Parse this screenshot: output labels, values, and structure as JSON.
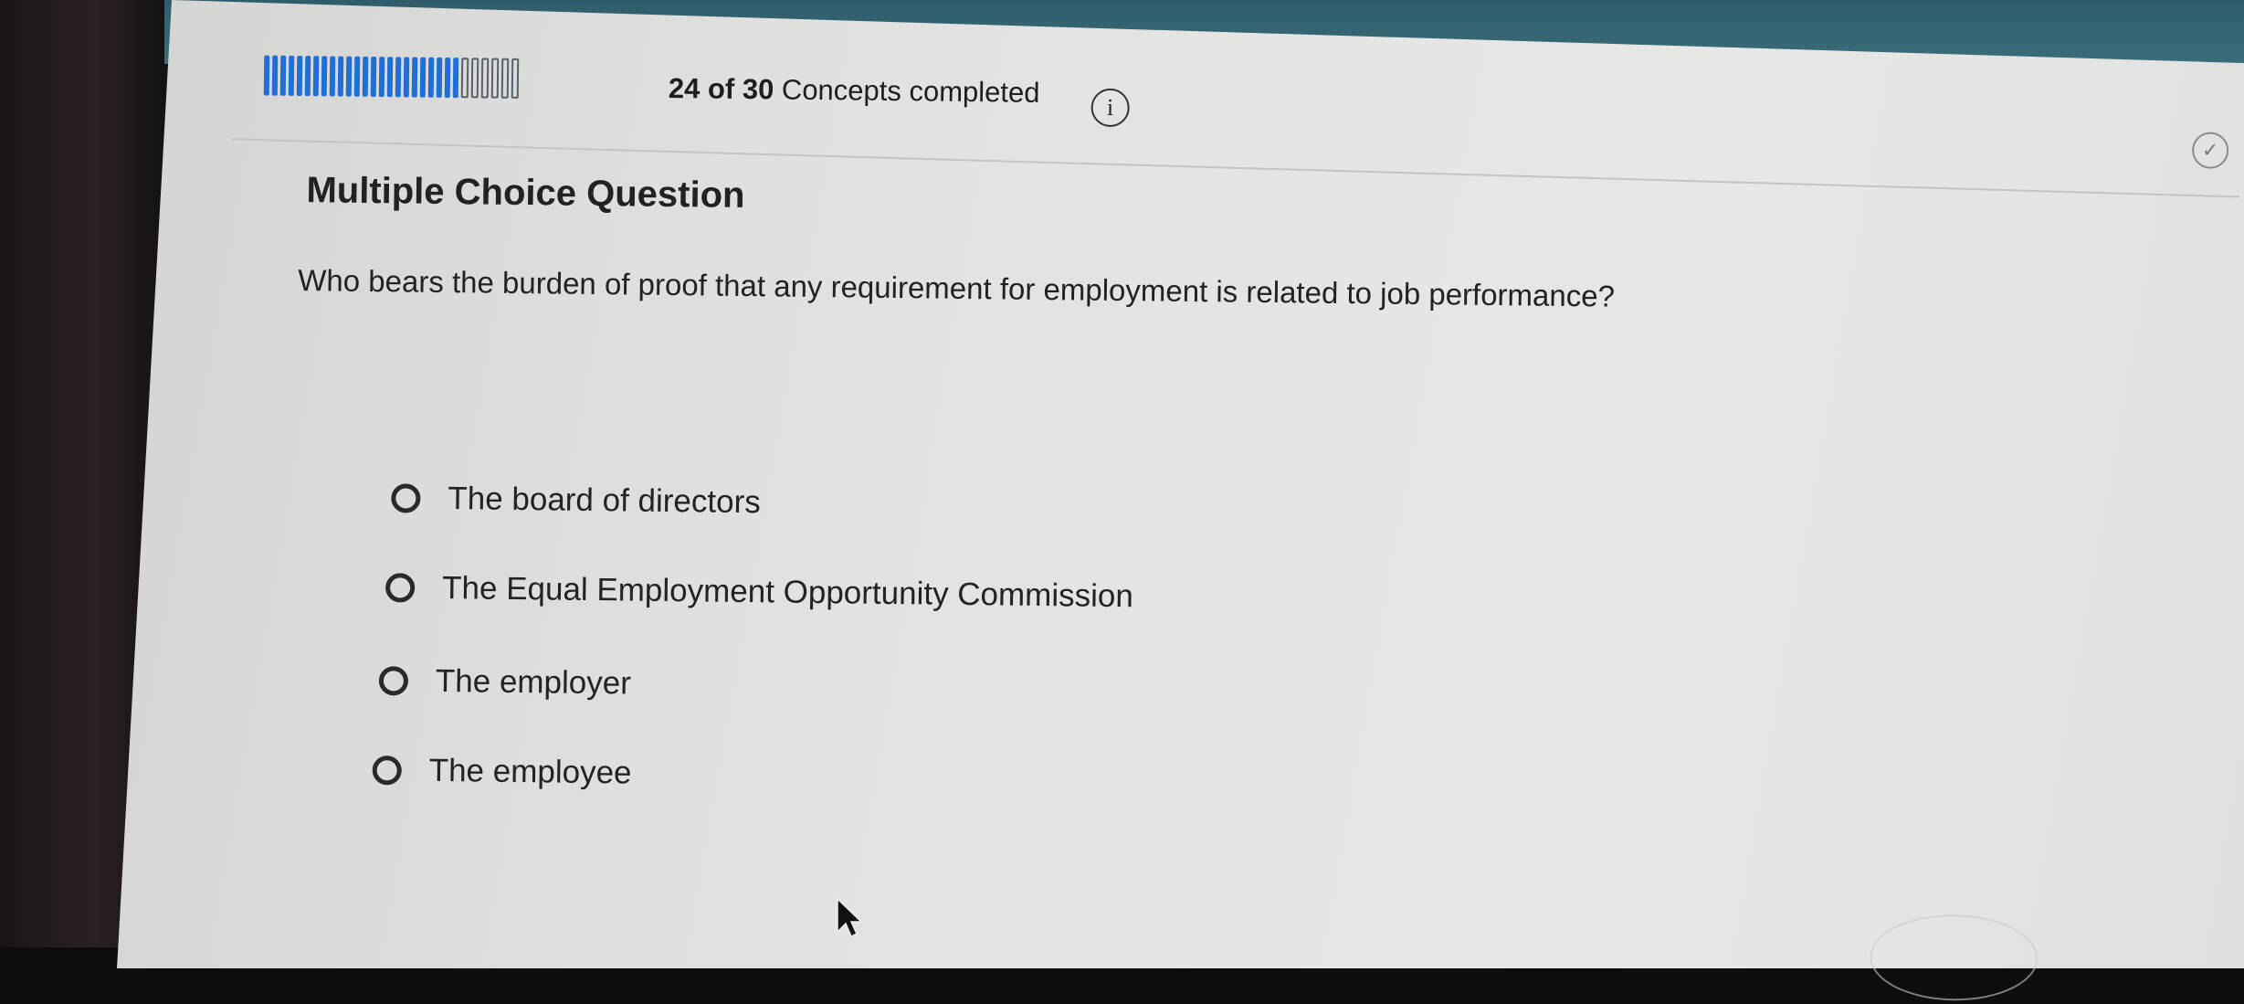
{
  "progress": {
    "completed": 24,
    "total": 30,
    "text_bold": "24 of 30",
    "text_rest": " Concepts completed",
    "info_icon": "i"
  },
  "question": {
    "type_label": "Multiple Choice Question",
    "prompt": "Who bears the burden of proof that any requirement for employment is related to job performance?",
    "options": [
      {
        "label": "The board of directors"
      },
      {
        "label": "The Equal Employment Opportunity Commission"
      },
      {
        "label": "The employer"
      },
      {
        "label": "The employee"
      }
    ]
  },
  "icons": {
    "info": "info-icon",
    "check": "check-circle-icon",
    "cursor": "mouse-cursor-icon"
  },
  "colors": {
    "progress_fill": "#1f6fd6",
    "progress_empty_border": "#58606a",
    "screen_bg": "#e2e2e0",
    "text": "#222222"
  }
}
